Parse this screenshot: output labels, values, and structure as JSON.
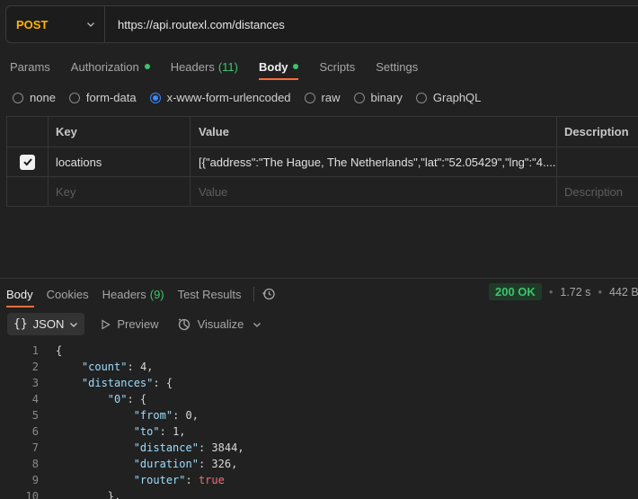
{
  "request": {
    "method": "POST",
    "url": "https://api.routexl.com/distances"
  },
  "req_tabs": [
    {
      "label": "Params"
    },
    {
      "label": "Authorization",
      "dot": true
    },
    {
      "label": "Headers",
      "count": "(11)"
    },
    {
      "label": "Body",
      "dot": true,
      "active": true
    },
    {
      "label": "Scripts"
    },
    {
      "label": "Settings"
    }
  ],
  "body_types": [
    {
      "label": "none",
      "selected": false
    },
    {
      "label": "form-data",
      "selected": false
    },
    {
      "label": "x-www-form-urlencoded",
      "selected": true
    },
    {
      "label": "raw",
      "selected": false
    },
    {
      "label": "binary",
      "selected": false
    },
    {
      "label": "GraphQL",
      "selected": false
    }
  ],
  "kv_table": {
    "headers": {
      "key": "Key",
      "value": "Value",
      "description": "Description"
    },
    "rows": [
      {
        "checked": true,
        "key": "locations",
        "value": "[{\"address\":\"The Hague, The Netherlands\",\"lat\":\"52.05429\",\"lng\":\"4....",
        "description": ""
      }
    ],
    "placeholders": {
      "key": "Key",
      "value": "Value",
      "description": "Description"
    }
  },
  "response": {
    "tabs": [
      {
        "label": "Body",
        "active": true
      },
      {
        "label": "Cookies"
      },
      {
        "label": "Headers",
        "count": "(9)"
      },
      {
        "label": "Test Results"
      }
    ],
    "status": "200 OK",
    "time": "1.72 s",
    "size": "442 B",
    "view_format": "JSON",
    "preview_label": "Preview",
    "visualize_label": "Visualize"
  },
  "code_lines": [
    {
      "n": "1",
      "html": "{"
    },
    {
      "n": "2",
      "html": "    <span class='k'>\"count\"</span>: <span class='n'>4</span>,"
    },
    {
      "n": "3",
      "html": "    <span class='k'>\"distances\"</span>: {"
    },
    {
      "n": "4",
      "html": "        <span class='k'>\"0\"</span>: {"
    },
    {
      "n": "5",
      "html": "            <span class='k'>\"from\"</span>: <span class='n'>0</span>,"
    },
    {
      "n": "6",
      "html": "            <span class='k'>\"to\"</span>: <span class='n'>1</span>,"
    },
    {
      "n": "7",
      "html": "            <span class='k'>\"distance\"</span>: <span class='n'>3844</span>,"
    },
    {
      "n": "8",
      "html": "            <span class='k'>\"duration\"</span>: <span class='n'>326</span>,"
    },
    {
      "n": "9",
      "html": "            <span class='k'>\"router\"</span>: <span class='b'>true</span>"
    },
    {
      "n": "10",
      "html": "        },"
    }
  ],
  "colors": {
    "accent": "#ff6c37",
    "method": "#ffb400",
    "success": "#3ec46d",
    "radio": "#3d8bfd"
  }
}
